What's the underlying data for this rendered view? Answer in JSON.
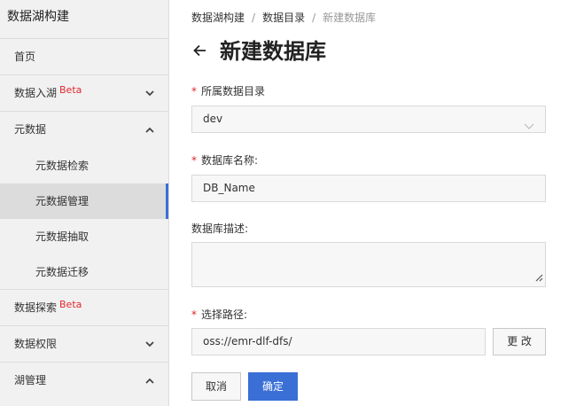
{
  "sidebar": {
    "title": "数据湖构建",
    "items": [
      {
        "label": "首页"
      },
      {
        "label": "数据入湖",
        "badge": "Beta",
        "icon": "chevron-down-icon"
      },
      {
        "label": "元数据",
        "icon": "chevron-up-icon"
      },
      {
        "label": "元数据检索"
      },
      {
        "label": "元数据管理"
      },
      {
        "label": "元数据抽取"
      },
      {
        "label": "元数据迁移"
      },
      {
        "label": "数据探索",
        "badge": "Beta"
      },
      {
        "label": "数据权限",
        "icon": "chevron-down-icon"
      },
      {
        "label": "湖管理",
        "icon": "chevron-up-icon"
      }
    ],
    "active_item": "元数据管理"
  },
  "breadcrumb": [
    "数据湖构建",
    "数据目录",
    "新建数据库"
  ],
  "page": {
    "title": "新建数据库",
    "back_icon": "arrow-left-icon"
  },
  "form": {
    "catalog": {
      "label": "所属数据目录",
      "required": true,
      "value": "dev"
    },
    "name": {
      "label": "数据库名称:",
      "required": true,
      "placeholder": "DB_Name"
    },
    "description": {
      "label": "数据库描述:",
      "required": false,
      "value": ""
    },
    "path": {
      "label": "选择路径:",
      "required": true,
      "value": "oss://emr-dlf-dfs/",
      "change_button": "更 改"
    }
  },
  "actions": {
    "cancel": "取消",
    "confirm": "确定"
  },
  "colors": {
    "primary": "#3a6fd6",
    "required": "#e0282e",
    "sidebar_bg": "#f1f1f1"
  }
}
